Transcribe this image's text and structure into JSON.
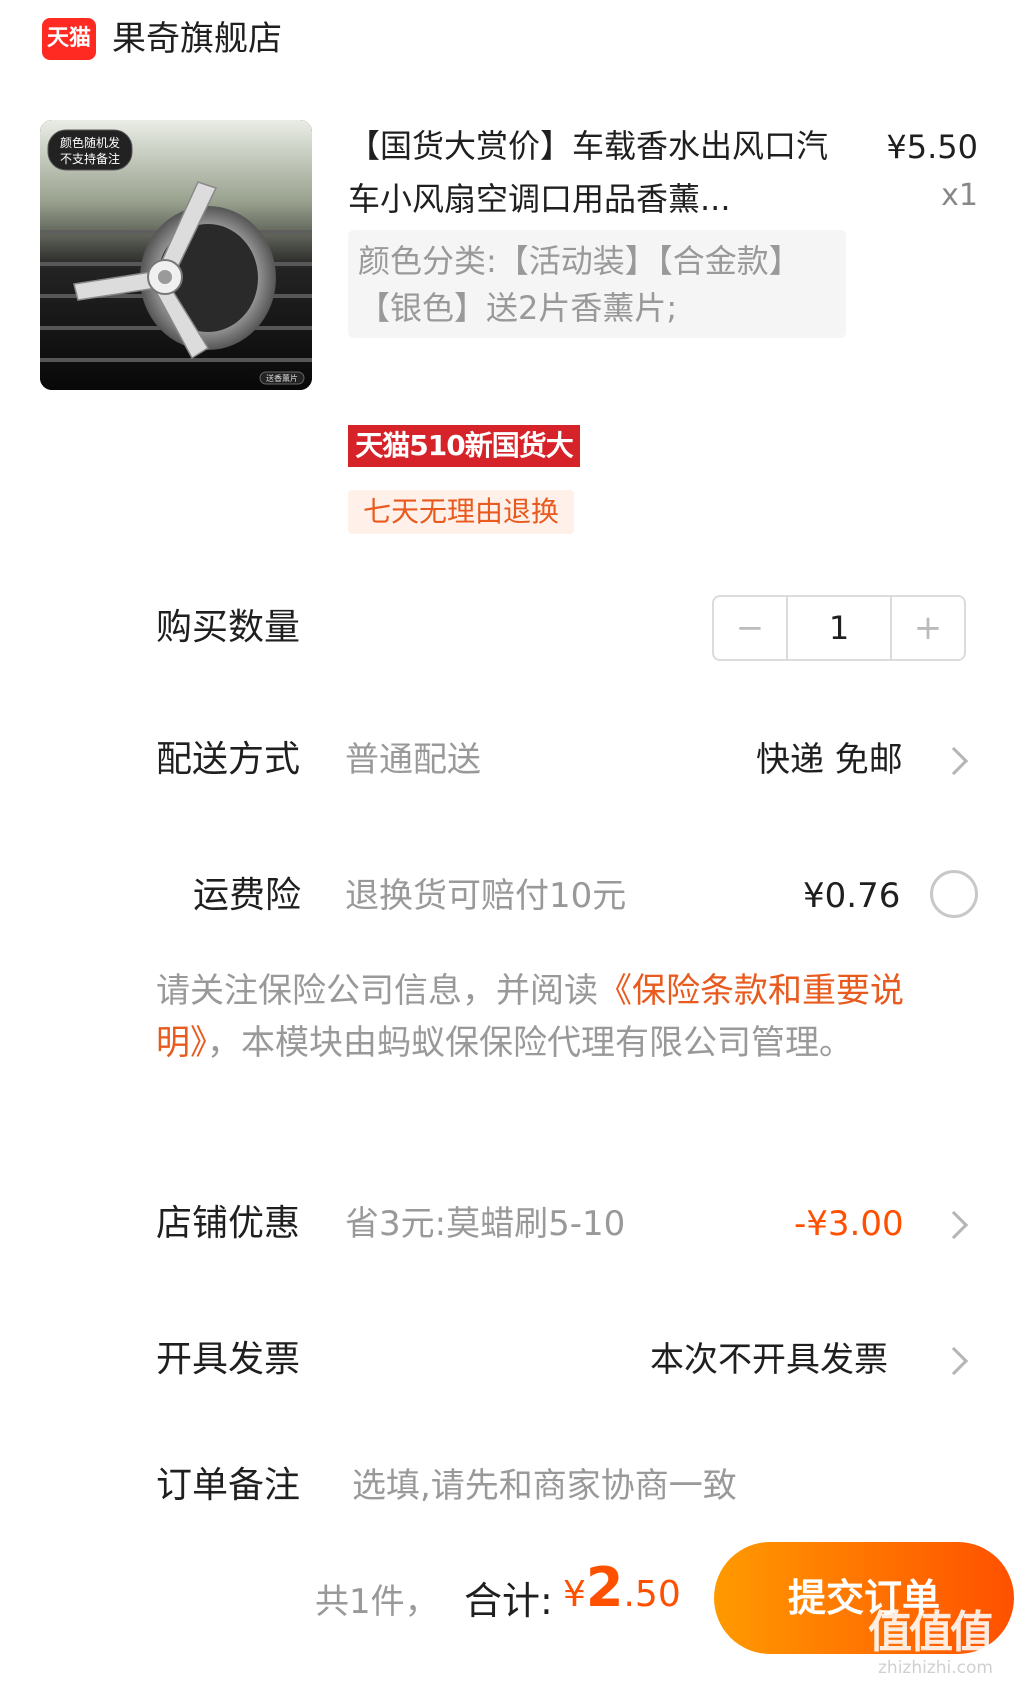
{
  "store": {
    "logo_text": "天猫",
    "name": "果奇旗舰店"
  },
  "product": {
    "image_overlay_text": "颜色随机发 不支持备注",
    "image_corner_text": "送香薰片",
    "title": "【国货大赏价】车载香水出风口汽车小风扇空调口用品香薰...",
    "price": "¥5.50",
    "quantity": "x1",
    "sku": "颜色分类:【活动装】【合金款】【银色】送2片香薰片;",
    "promo_banner": "天猫510新国货大赏",
    "return_tag": "七天无理由退换"
  },
  "purchase_quantity": {
    "label": "购买数量",
    "value": "1",
    "minus": "−",
    "plus": "+"
  },
  "delivery": {
    "label": "配送方式",
    "method": "普通配送",
    "value": "快递 免邮"
  },
  "shipping_insurance": {
    "label": "运费险",
    "description": "退换货可赔付10元",
    "price": "¥0.76"
  },
  "insurance_note": {
    "prefix": "请关注保险公司信息，并阅读",
    "link": "《保险条款和重要说明》",
    "suffix": "，本模块由蚂蚁保保险代理有限公司管理。"
  },
  "store_discount": {
    "label": "店铺优惠",
    "description": "省3元:莫蜡刷5-10",
    "value": "-¥3.00"
  },
  "invoice": {
    "label": "开具发票",
    "value": "本次不开具发票"
  },
  "order_note": {
    "label": "订单备注",
    "placeholder": "选填,请先和商家协商一致"
  },
  "bottom_bar": {
    "count": "共1件，",
    "total_label": "合计:",
    "total_currency": "¥",
    "total_int": "2",
    "total_decimal": ".50",
    "submit": "提交订单"
  },
  "watermark": {
    "text": "值值值",
    "url": "zhizhizhi.com"
  }
}
